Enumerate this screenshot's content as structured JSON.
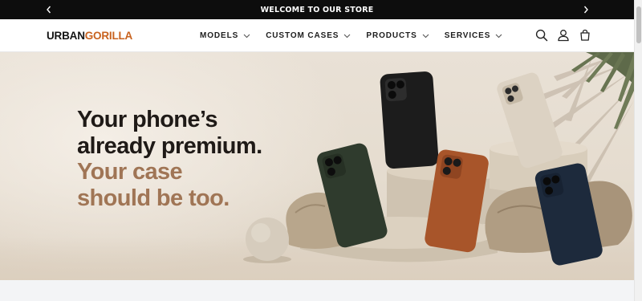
{
  "announcement": {
    "text": "WELCOME TO OUR STORE",
    "prev_icon": "chevron-left-icon",
    "next_icon": "chevron-right-icon"
  },
  "header": {
    "logo_part1": "URBAN",
    "logo_part2": "GORILLA",
    "nav": [
      {
        "label": "MODELS"
      },
      {
        "label": "CUSTOM CASES"
      },
      {
        "label": "PRODUCTS"
      },
      {
        "label": "SERVICES"
      }
    ],
    "icons": [
      "search-icon",
      "account-icon",
      "cart-icon"
    ]
  },
  "hero": {
    "line1": "Your phone’s",
    "line2": "already premium.",
    "line3": "Your case",
    "line4": "should be too."
  },
  "colors": {
    "announcement_bg": "#0d0d0d",
    "logo_accent": "#c8621e",
    "headline_dark": "#1f1a17",
    "headline_tan": "#a07555",
    "hero_bg": "#e7dfd3"
  }
}
